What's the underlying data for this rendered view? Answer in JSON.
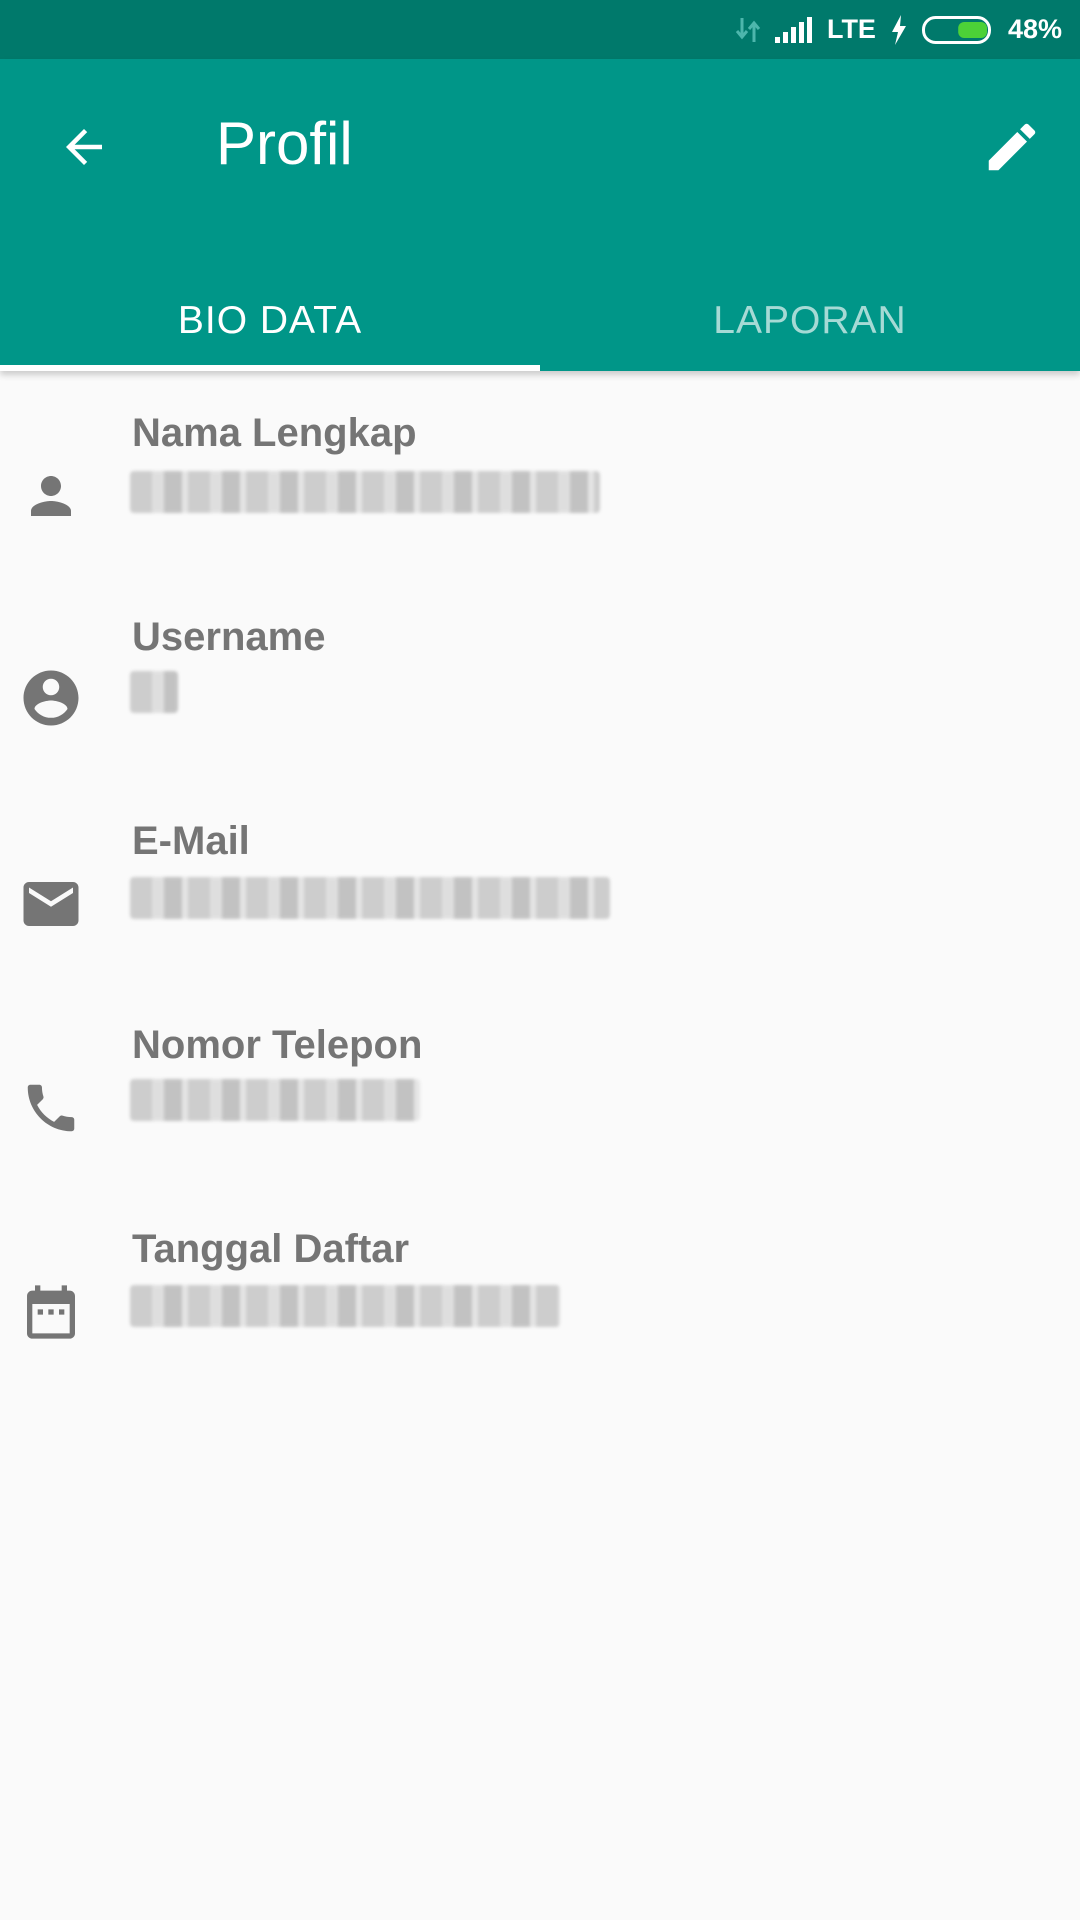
{
  "status_bar": {
    "network": "LTE",
    "battery_percent": "48%",
    "battery_level": 0.48,
    "icons": [
      "data-arrows-icon",
      "signal-icon",
      "charging-icon",
      "battery-icon"
    ]
  },
  "app_bar": {
    "title": "Profil",
    "back_icon": "arrow-back-icon",
    "edit_icon": "pencil-icon",
    "background": "#009688",
    "status_background": "#00796b"
  },
  "tabs": [
    {
      "label": "BIO DATA",
      "active": true
    },
    {
      "label": "LAPORAN",
      "active": false
    }
  ],
  "fields": [
    {
      "label": "Nama Lengkap",
      "icon": "person-icon",
      "value_redacted": true
    },
    {
      "label": "Username",
      "icon": "account-circle-icon",
      "value_redacted": true
    },
    {
      "label": "E-Mail",
      "icon": "mail-icon",
      "value_redacted": true
    },
    {
      "label": "Nomor Telepon",
      "icon": "phone-icon",
      "value_redacted": true
    },
    {
      "label": "Tanggal Daftar",
      "icon": "calendar-icon",
      "value_redacted": true
    }
  ]
}
